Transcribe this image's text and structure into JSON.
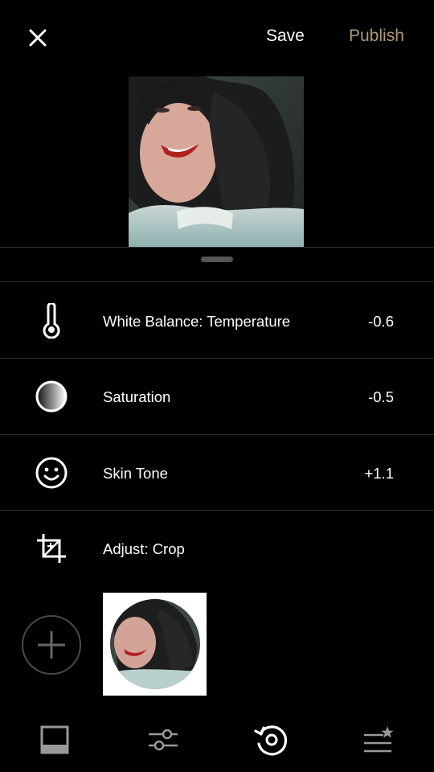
{
  "header": {
    "close_icon": "close-icon",
    "save_label": "Save",
    "publish_label": "Publish",
    "publish_color": "#b39a73"
  },
  "edits": [
    {
      "icon": "thermometer-icon",
      "label": "White Balance: Temperature",
      "value": "-0.6"
    },
    {
      "icon": "saturation-icon",
      "label": "Saturation",
      "value": "-0.5"
    },
    {
      "icon": "smiley-icon",
      "label": "Skin Tone",
      "value": "+1.1"
    },
    {
      "icon": "crop-icon",
      "label": "Adjust: Crop",
      "value": ""
    }
  ],
  "recipe": {
    "add_icon": "plus-icon"
  },
  "bottom_tabs": [
    {
      "icon": "presets-icon"
    },
    {
      "icon": "sliders-icon"
    },
    {
      "icon": "history-icon",
      "active": true
    },
    {
      "icon": "recipes-icon"
    }
  ]
}
